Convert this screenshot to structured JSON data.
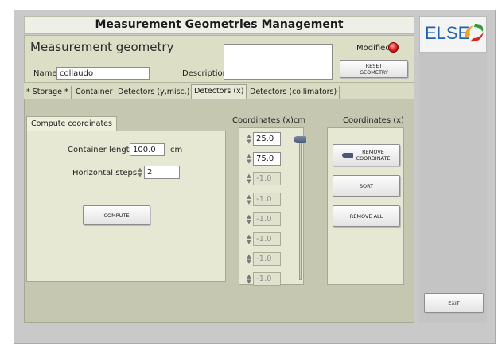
{
  "app": {
    "title": "Measurement Geometries Management",
    "logo_text": "ELSE",
    "accent_color": "#1f63b0",
    "logo_swirl_colors": [
      "#f2a31f",
      "#d9261c",
      "#2f9b3c"
    ]
  },
  "header": {
    "section_title": "Measurement geometry",
    "name_label": "Name",
    "name_value": "collaudo",
    "description_label": "Description",
    "description_value": "",
    "modified_label": "Modified",
    "modified_led_color": "#e31b1b",
    "reset_label_line1": "RESET",
    "reset_label_line2": "GEOMETRY"
  },
  "tabs": [
    {
      "label": "* Storage *"
    },
    {
      "label": "Container"
    },
    {
      "label": "Detectors (y,misc.)"
    },
    {
      "label": "Detectors (x)",
      "active": true
    },
    {
      "label": "Detectors (collimators)"
    }
  ],
  "compute": {
    "sub_tab_label": "Compute coordinates",
    "container_length_label": "Container length",
    "container_length_value": "100.0",
    "container_length_unit": "cm",
    "horizontal_steps_label": "Horizontal steps",
    "horizontal_steps_value": "2",
    "compute_button": "COMPUTE"
  },
  "coordinates": {
    "header_label": "Coordinates (x)cm",
    "values": [
      "25.0",
      "75.0",
      "-1.0",
      "-1.0",
      "-1.0",
      "-1.0",
      "-1.0",
      "-1.0"
    ],
    "enabled_count": 2
  },
  "actions": {
    "header_label": "Coordinates (x)",
    "remove_coordinate_line1": "REMOVE",
    "remove_coordinate_line2": "COORDINATE",
    "sort_button": "SORT",
    "remove_all_button": "REMOVE ALL"
  },
  "exit_button": "EXIT"
}
